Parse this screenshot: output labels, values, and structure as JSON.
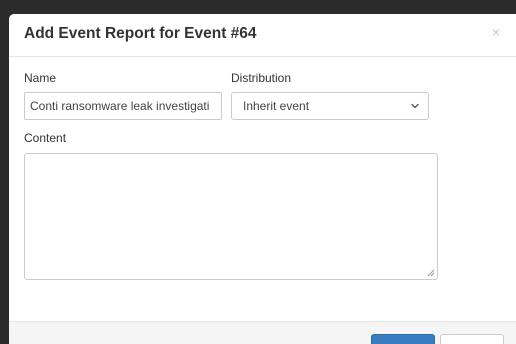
{
  "modal": {
    "title": "Add Event Report for Event #64",
    "close_glyph": "×"
  },
  "form": {
    "name_label": "Name",
    "name_value": "Conti ransomware leak investigati",
    "distribution_label": "Distribution",
    "distribution_value": "Inherit event",
    "content_label": "Content",
    "content_value": ""
  },
  "colors": {
    "primary_button": "#3a7cc0",
    "backdrop": "#2b2b2b"
  }
}
